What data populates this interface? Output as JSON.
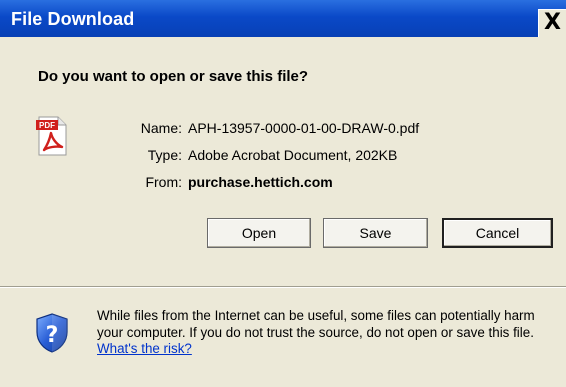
{
  "window": {
    "title": "File Download",
    "close_label": "X"
  },
  "prompt": {
    "question": "Do you want to open or save this file?"
  },
  "file": {
    "icon": "pdf-file-icon",
    "icon_badge": "PDF",
    "name_label": "Name:",
    "name_value": "APH-13957-0000-01-00-DRAW-0.pdf",
    "type_label": "Type:",
    "type_value": "Adobe Acrobat Document, 202KB",
    "from_label": "From:",
    "from_value": "purchase.hettich.com"
  },
  "buttons": {
    "open_label": "Open",
    "save_label": "Save",
    "cancel_label": "Cancel"
  },
  "warning": {
    "icon": "security-shield-question-icon",
    "text": "While files from the Internet can be useful, some files can potentially harm your computer. If you do not trust the source, do not open or save this file. ",
    "link_text": "What's the risk?"
  },
  "colors": {
    "titlebar": "#0a49c8",
    "dialog_bg": "#ece9d8",
    "link": "#0033cc",
    "pdf_red": "#d0201c"
  }
}
